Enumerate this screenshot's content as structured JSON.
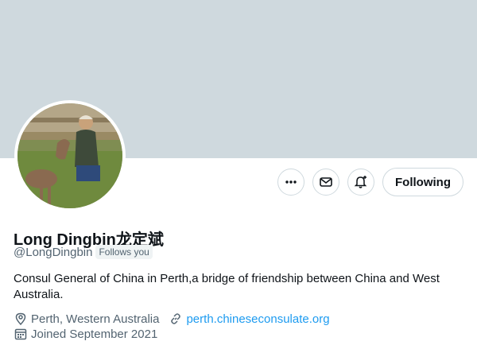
{
  "profile": {
    "display_name": "Long Dingbin龙定斌",
    "handle": "@LongDingbin",
    "follows_you_badge": "Follows you",
    "bio": "Consul General of China in Perth,a bridge of friendship between China and West Australia.",
    "location": "Perth, Western Australia",
    "website": "perth.chineseconsulate.org",
    "joined": "Joined September 2021"
  },
  "actions": {
    "more_icon": "more-horizontal-icon",
    "message_icon": "envelope-icon",
    "notify_icon": "bell-plus-icon",
    "follow_label": "Following"
  },
  "colors": {
    "banner": "#cfd9de",
    "link": "#1d9bf0",
    "secondary_text": "#536471"
  }
}
